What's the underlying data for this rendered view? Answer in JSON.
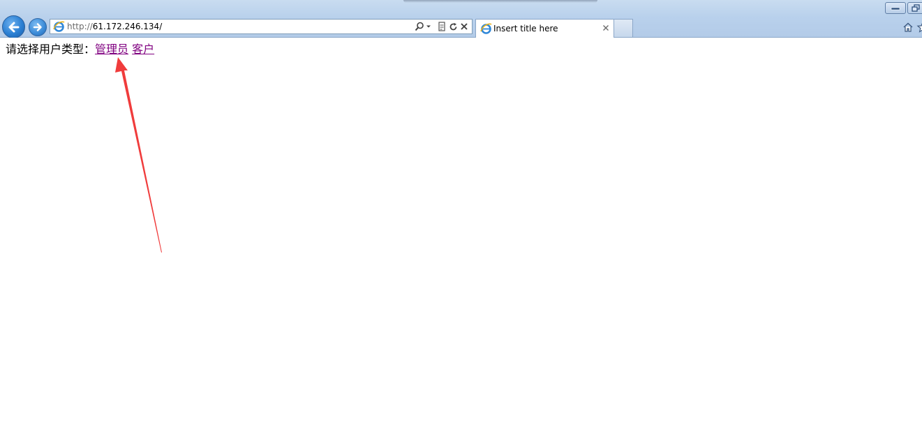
{
  "browser": {
    "address": {
      "protocol": "http://",
      "host": "61.172.246.134/"
    },
    "tab": {
      "title": "Insert title here"
    }
  },
  "page": {
    "prompt_label": "请选择用户类型：",
    "links": [
      {
        "label": "管理员"
      },
      {
        "label": "客户"
      }
    ]
  },
  "colors": {
    "visited_link": "#800080",
    "annotation_arrow": "#f03c3c"
  },
  "icons": [
    "back-arrow-icon",
    "forward-arrow-icon",
    "ie-logo-icon",
    "search-icon",
    "dropdown-icon",
    "compatibility-view-icon",
    "refresh-icon",
    "stop-icon",
    "tab-close-icon",
    "minimize-icon",
    "restore-icon",
    "home-icon",
    "favorites-star-icon"
  ]
}
